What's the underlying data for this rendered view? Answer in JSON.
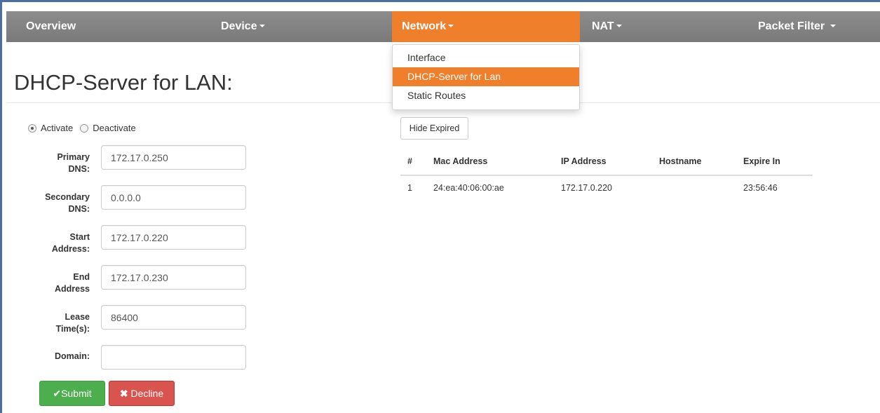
{
  "nav": {
    "items": [
      {
        "label": "Overview"
      },
      {
        "label": "Device"
      },
      {
        "label": "Network"
      },
      {
        "label": "NAT"
      },
      {
        "label": "Packet Filter"
      }
    ],
    "dropdown": [
      "Interface",
      "DHCP-Server for Lan",
      "Static Routes"
    ]
  },
  "page": {
    "title": "DHCP-Server for LAN:"
  },
  "mode": {
    "activate": "Activate",
    "deactivate": "Deactivate",
    "selected": "Activate"
  },
  "form": {
    "primary_dns": {
      "label_1": "Primary",
      "label_2": "DNS:",
      "value": "172.17.0.250"
    },
    "secondary_dns": {
      "label_1": "Secondary",
      "label_2": "DNS:",
      "value": "0.0.0.0"
    },
    "start_address": {
      "label_1": "Start",
      "label_2": "Address:",
      "value": "172.17.0.220"
    },
    "end_address": {
      "label_1": "End",
      "label_2": "Address",
      "value": "172.17.0.230"
    },
    "lease_time": {
      "label_1": "Lease",
      "label_2": "Time(s):",
      "value": "86400"
    },
    "domain": {
      "label": "Domain:",
      "value": ""
    },
    "submit": "Submit",
    "decline": "Decline"
  },
  "leases": {
    "hide_button": "Hide Expired",
    "headers": [
      "#",
      "Mac Address",
      "IP Address",
      "Hostname",
      "Expire In"
    ],
    "rows": [
      [
        "1",
        "24:ea:40:06:00:ae",
        "172.17.0.220",
        "",
        "23:56:46"
      ]
    ]
  },
  "colors": {
    "nav_active": "#f07f2c",
    "nav_bg": "#848484",
    "submit": "#4cae4c",
    "decline": "#d9534f"
  }
}
